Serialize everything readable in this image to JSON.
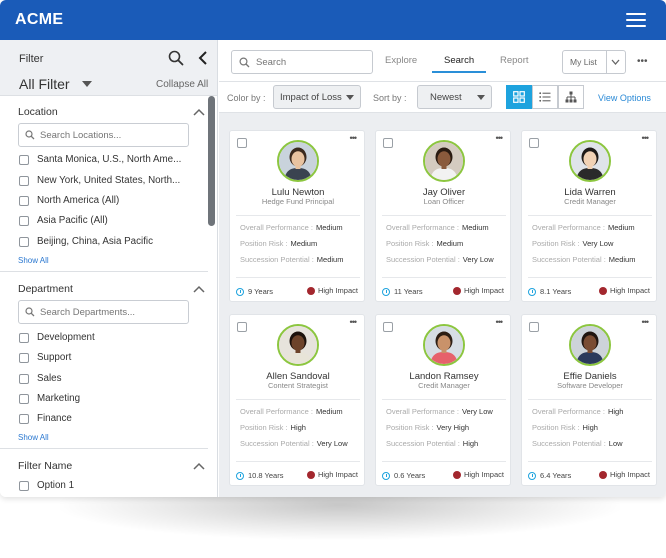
{
  "app": {
    "brand": "ACME"
  },
  "sidebar": {
    "filter_label": "Filter",
    "all_filter_label": "All Filter",
    "collapse_all": "Collapse All",
    "location": {
      "title": "Location",
      "search_placeholder": "Search Locations...",
      "items": [
        "Santa Monica, U.S., North Ame...",
        "New York, United States, North...",
        "North America (All)",
        "Asia Pacific (All)",
        "Beijing, China, Asia Pacific"
      ],
      "show_all": "Show All"
    },
    "department": {
      "title": "Department",
      "search_placeholder": "Search Departments...",
      "items": [
        "Development",
        "Support",
        "Sales",
        "Marketing",
        "Finance"
      ],
      "show_all": "Show All"
    },
    "filter_name": {
      "title": "Filter Name",
      "items": [
        "Option 1"
      ]
    }
  },
  "toolbar": {
    "search_placeholder": "Search",
    "tabs": [
      "Explore",
      "Search",
      "Report"
    ],
    "active_tab": "Search",
    "my_list": "My List",
    "color_by_label": "Color by :",
    "color_by_value": "Impact of Loss",
    "sort_by_label": "Sort by :",
    "sort_by_value": "Newest",
    "view_options": "View Options",
    "active_view": "grid"
  },
  "labels": {
    "overall_performance": "Overall Performance :",
    "position_risk": "Position Risk :",
    "succession_potential": "Succession Potential :"
  },
  "colors": {
    "brand_blue": "#1a5bb8",
    "accent_blue": "#1ea3de",
    "avatar_ring": "#8cc63f",
    "impact_red": "#a3272e"
  },
  "cards": [
    {
      "name": "Lulu Newton",
      "title": "Hedge Fund Principal",
      "overall_performance": "Medium",
      "position_risk": "Medium",
      "succession_potential": "Medium",
      "years": "9 Years",
      "impact": "High Impact"
    },
    {
      "name": "Jay Oliver",
      "title": "Loan Officer",
      "overall_performance": "Medium",
      "position_risk": "Medium",
      "succession_potential": "Very Low",
      "years": "11 Years",
      "impact": "High Impact"
    },
    {
      "name": "Lida Warren",
      "title": "Credit Manager",
      "overall_performance": "Medium",
      "position_risk": "Very Low",
      "succession_potential": "Medium",
      "years": "8.1 Years",
      "impact": "High Impact"
    },
    {
      "name": "Allen Sandoval",
      "title": "Content Strategist",
      "overall_performance": "Medium",
      "position_risk": "High",
      "succession_potential": "Very Low",
      "years": "10.8 Years",
      "impact": "High Impact"
    },
    {
      "name": "Landon Ramsey",
      "title": "Credit Manager",
      "overall_performance": "Very Low",
      "position_risk": "Very High",
      "succession_potential": "High",
      "years": "0.6 Years",
      "impact": "High Impact"
    },
    {
      "name": "Effie Daniels",
      "title": "Software Developer",
      "overall_performance": "High",
      "position_risk": "High",
      "succession_potential": "Low",
      "years": "6.4 Years",
      "impact": "High Impact"
    }
  ]
}
